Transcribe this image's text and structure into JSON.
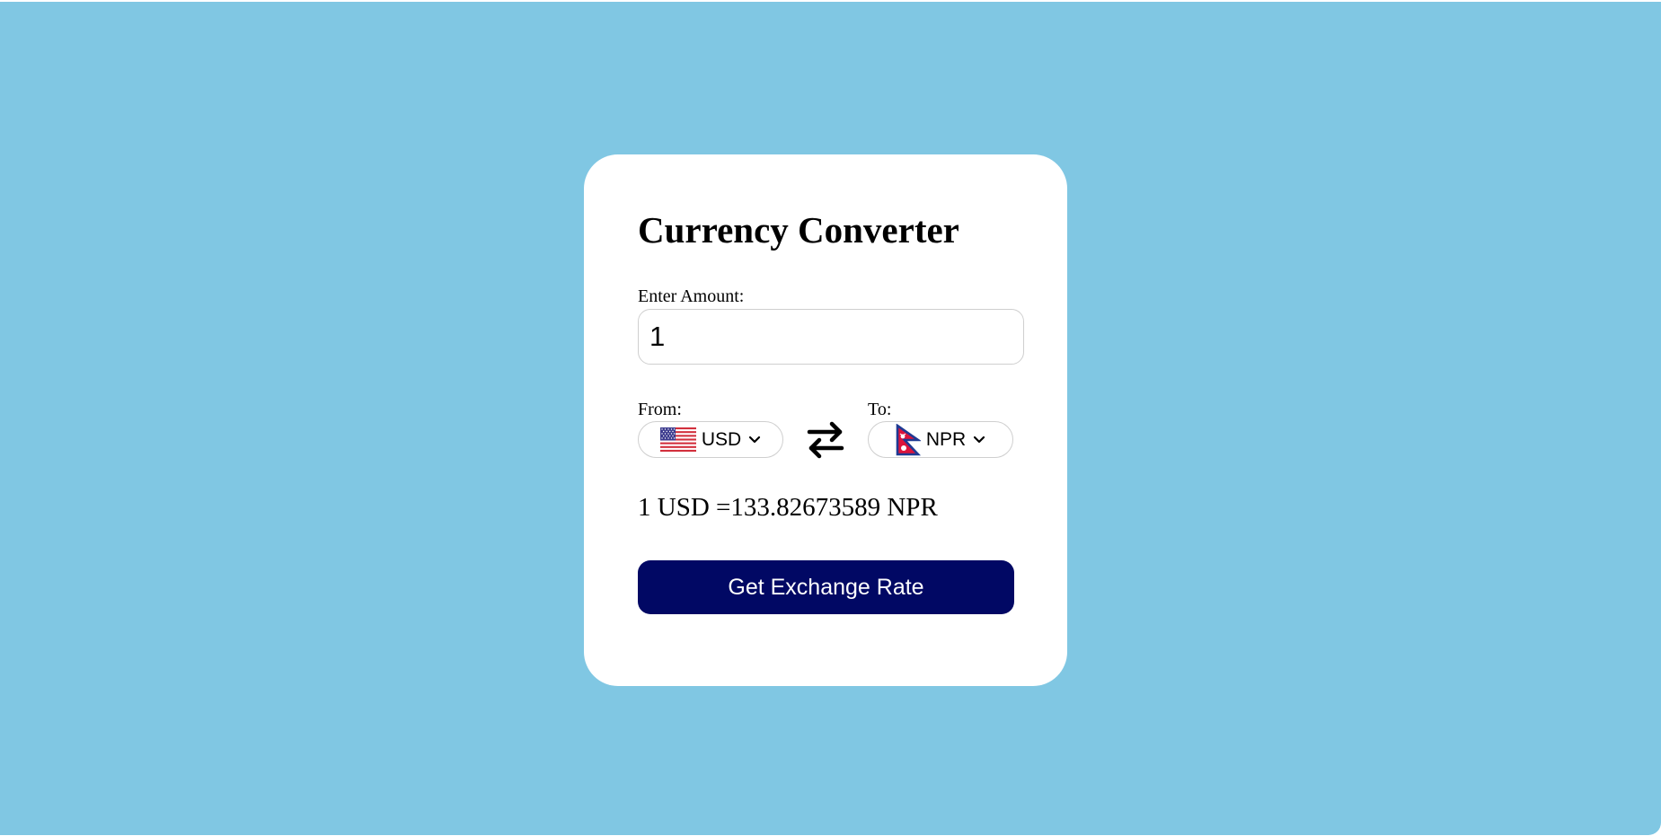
{
  "app": {
    "title": "Currency Converter"
  },
  "amount": {
    "label": "Enter Amount:",
    "value": "1"
  },
  "from": {
    "label": "From:",
    "currency": "USD",
    "flag_icon": "us-flag-icon"
  },
  "to": {
    "label": "To:",
    "currency": "NPR",
    "flag_icon": "nepal-flag-icon"
  },
  "swap": {
    "icon": "swap-arrows-icon"
  },
  "result": {
    "text": "1 USD =133.82673589 NPR"
  },
  "button": {
    "label": "Get Exchange Rate"
  },
  "colors": {
    "background": "#80c7e3",
    "card": "#ffffff",
    "button": "#010864",
    "button_text": "#ffffff"
  }
}
